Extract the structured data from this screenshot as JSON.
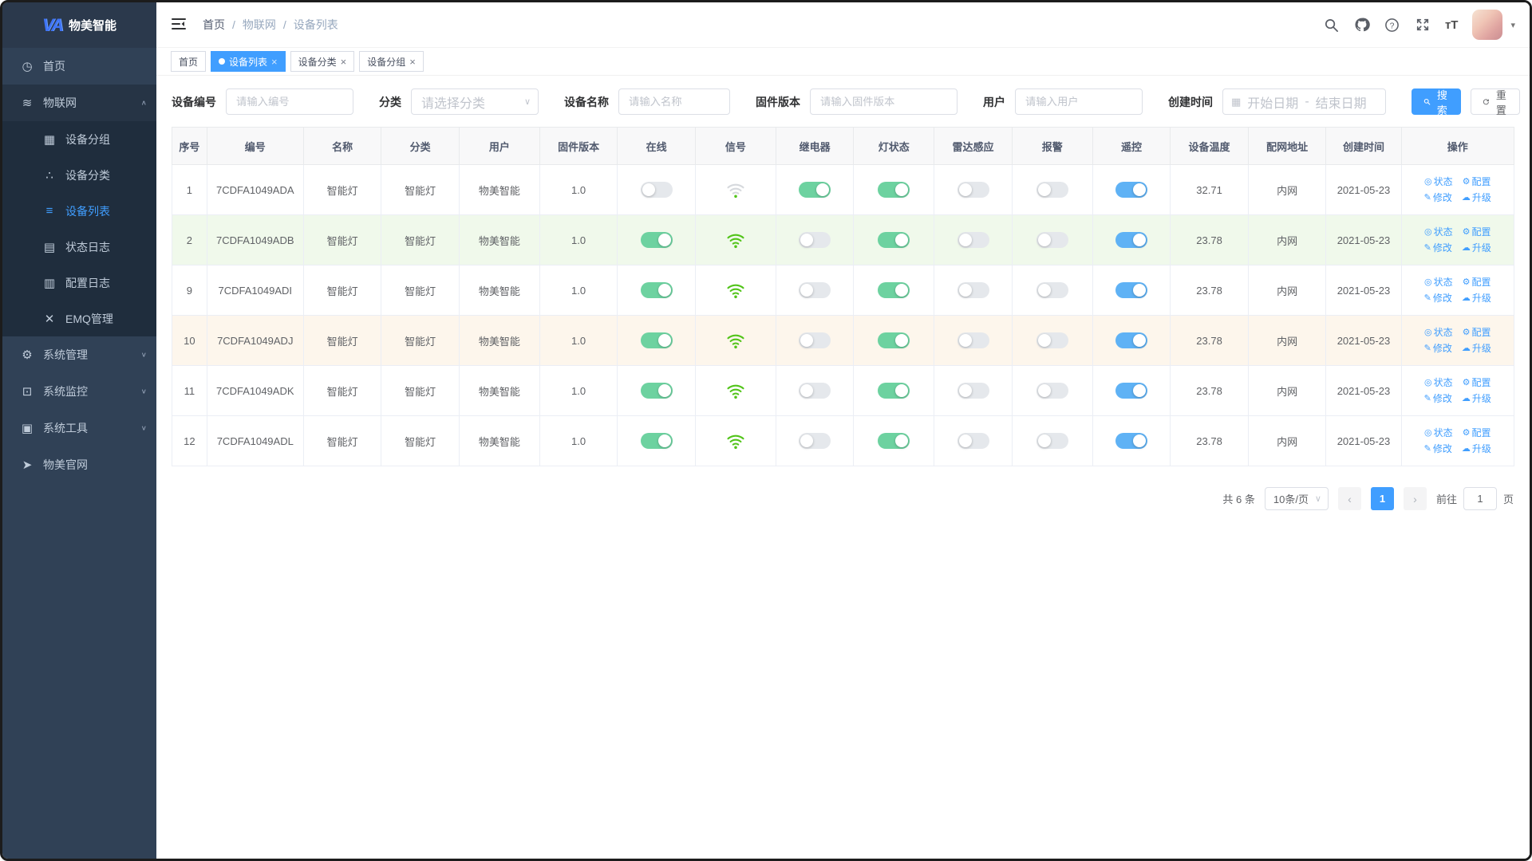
{
  "app": {
    "logo_mark": "VA",
    "logo_text": "物美智能"
  },
  "colors": {
    "primary": "#409eff",
    "sidebar_bg": "#304156",
    "submenu_bg": "#1f2d3d",
    "toggle_green": "#6dd2a0",
    "toggle_blue": "#5fb2f5",
    "row_tint_green": "#f0f9eb",
    "row_tint_orange": "#fdf6ec"
  },
  "sidebar": {
    "menu": [
      {
        "id": "home",
        "label": "首页",
        "icon": "dashboard-icon"
      },
      {
        "id": "iot",
        "label": "物联网",
        "icon": "iot-icon",
        "expanded": true,
        "children": [
          {
            "id": "device-group",
            "label": "设备分组",
            "icon": "grid-icon"
          },
          {
            "id": "device-category",
            "label": "设备分类",
            "icon": "category-icon"
          },
          {
            "id": "device-list",
            "label": "设备列表",
            "icon": "list-icon",
            "active": true
          },
          {
            "id": "status-log",
            "label": "状态日志",
            "icon": "status-log-icon"
          },
          {
            "id": "config-log",
            "label": "配置日志",
            "icon": "config-log-icon"
          },
          {
            "id": "emq",
            "label": "EMQ管理",
            "icon": "emq-icon"
          }
        ]
      },
      {
        "id": "system-mgmt",
        "label": "系统管理",
        "icon": "gear-icon",
        "expanded": false,
        "children": []
      },
      {
        "id": "system-monitor",
        "label": "系统监控",
        "icon": "monitor-icon",
        "expanded": false,
        "children": []
      },
      {
        "id": "system-tools",
        "label": "系统工具",
        "icon": "toolbox-icon",
        "expanded": false,
        "children": []
      },
      {
        "id": "official-site",
        "label": "物美官网",
        "icon": "paper-plane-icon"
      }
    ]
  },
  "navbar": {
    "breadcrumb": [
      "首页",
      "物联网",
      "设备列表"
    ],
    "breadcrumb_separator": "/",
    "right_icons": [
      "search-icon",
      "github-icon",
      "question-icon",
      "fullscreen-icon",
      "font-size-icon"
    ]
  },
  "tags": [
    {
      "id": "home",
      "label": "首页",
      "active": false,
      "closable": false
    },
    {
      "id": "device-list",
      "label": "设备列表",
      "active": true,
      "closable": true
    },
    {
      "id": "device-category",
      "label": "设备分类",
      "active": false,
      "closable": true
    },
    {
      "id": "device-group",
      "label": "设备分组",
      "active": false,
      "closable": true
    }
  ],
  "filters": {
    "fields": [
      {
        "id": "device-code",
        "label": "设备编号",
        "type": "input",
        "placeholder": "请输入编号",
        "value": ""
      },
      {
        "id": "category",
        "label": "分类",
        "type": "select",
        "placeholder": "请选择分类",
        "value": ""
      },
      {
        "id": "device-name",
        "label": "设备名称",
        "type": "input",
        "placeholder": "请输入名称",
        "value": ""
      },
      {
        "id": "firmware",
        "label": "固件版本",
        "type": "input",
        "placeholder": "请输入固件版本",
        "value": ""
      },
      {
        "id": "user",
        "label": "用户",
        "type": "input",
        "placeholder": "请输入用户",
        "value": ""
      },
      {
        "id": "created",
        "label": "创建时间",
        "type": "daterange",
        "start_placeholder": "开始日期",
        "separator": "-",
        "end_placeholder": "结束日期"
      }
    ],
    "search_label": "搜索",
    "reset_label": "重置"
  },
  "table": {
    "columns": [
      {
        "key": "index",
        "label": "序号",
        "type": "text",
        "width": "2.6%"
      },
      {
        "key": "code",
        "label": "编号",
        "type": "text",
        "width": "7.2%"
      },
      {
        "key": "name",
        "label": "名称",
        "type": "text",
        "width": "5.8%"
      },
      {
        "key": "category",
        "label": "分类",
        "type": "text",
        "width": "5.8%"
      },
      {
        "key": "user",
        "label": "用户",
        "type": "text",
        "width": "6.0%"
      },
      {
        "key": "firmware",
        "label": "固件版本",
        "type": "text",
        "width": "5.8%"
      },
      {
        "key": "online",
        "label": "在线",
        "type": "switch-green",
        "width": "5.8%"
      },
      {
        "key": "signal",
        "label": "信号",
        "type": "wifi",
        "width": "6.0%"
      },
      {
        "key": "relay",
        "label": "继电器",
        "type": "switch-green",
        "width": "5.8%"
      },
      {
        "key": "light",
        "label": "灯状态",
        "type": "switch-green",
        "width": "6.0%"
      },
      {
        "key": "radar",
        "label": "雷达感应",
        "type": "switch-green",
        "width": "5.8%"
      },
      {
        "key": "alarm",
        "label": "报警",
        "type": "switch-green",
        "width": "6.0%"
      },
      {
        "key": "remote",
        "label": "遥控",
        "type": "switch-blue",
        "width": "5.8%"
      },
      {
        "key": "temperature",
        "label": "设备温度",
        "type": "text",
        "width": "5.8%"
      },
      {
        "key": "network",
        "label": "配网地址",
        "type": "text",
        "width": "5.8%"
      },
      {
        "key": "created",
        "label": "创建时间",
        "type": "text",
        "width": "5.6%"
      },
      {
        "key": "actions",
        "label": "操作",
        "type": "actions",
        "width": "8.4%"
      }
    ],
    "actions": [
      {
        "id": "status",
        "label": "状态",
        "icon": "view-icon"
      },
      {
        "id": "config",
        "label": "配置",
        "icon": "config-icon"
      },
      {
        "id": "edit",
        "label": "修改",
        "icon": "edit-icon"
      },
      {
        "id": "upgrade",
        "label": "升级",
        "icon": "upgrade-icon"
      }
    ],
    "rows": [
      {
        "index": "1",
        "code": "7CDFA1049ADA",
        "name": "智能灯",
        "category": "智能灯",
        "user": "物美智能",
        "firmware": "1.0",
        "online": false,
        "signal": "weak",
        "relay": true,
        "light": true,
        "radar": false,
        "alarm": false,
        "remote": true,
        "temperature": "32.71",
        "network": "内网",
        "created": "2021-05-23",
        "tint": "none"
      },
      {
        "index": "2",
        "code": "7CDFA1049ADB",
        "name": "智能灯",
        "category": "智能灯",
        "user": "物美智能",
        "firmware": "1.0",
        "online": true,
        "signal": "strong",
        "relay": false,
        "light": true,
        "radar": false,
        "alarm": false,
        "remote": true,
        "temperature": "23.78",
        "network": "内网",
        "created": "2021-05-23",
        "tint": "green"
      },
      {
        "index": "9",
        "code": "7CDFA1049ADI",
        "name": "智能灯",
        "category": "智能灯",
        "user": "物美智能",
        "firmware": "1.0",
        "online": true,
        "signal": "strong",
        "relay": false,
        "light": true,
        "radar": false,
        "alarm": false,
        "remote": true,
        "temperature": "23.78",
        "network": "内网",
        "created": "2021-05-23",
        "tint": "none"
      },
      {
        "index": "10",
        "code": "7CDFA1049ADJ",
        "name": "智能灯",
        "category": "智能灯",
        "user": "物美智能",
        "firmware": "1.0",
        "online": true,
        "signal": "strong",
        "relay": false,
        "light": true,
        "radar": false,
        "alarm": false,
        "remote": true,
        "temperature": "23.78",
        "network": "内网",
        "created": "2021-05-23",
        "tint": "orange"
      },
      {
        "index": "11",
        "code": "7CDFA1049ADK",
        "name": "智能灯",
        "category": "智能灯",
        "user": "物美智能",
        "firmware": "1.0",
        "online": true,
        "signal": "strong",
        "relay": false,
        "light": true,
        "radar": false,
        "alarm": false,
        "remote": true,
        "temperature": "23.78",
        "network": "内网",
        "created": "2021-05-23",
        "tint": "none"
      },
      {
        "index": "12",
        "code": "7CDFA1049ADL",
        "name": "智能灯",
        "category": "智能灯",
        "user": "物美智能",
        "firmware": "1.0",
        "online": true,
        "signal": "strong",
        "relay": false,
        "light": true,
        "radar": false,
        "alarm": false,
        "remote": true,
        "temperature": "23.78",
        "network": "内网",
        "created": "2021-05-23",
        "tint": "none"
      }
    ]
  },
  "pagination": {
    "total_text": "共 6 条",
    "page_size_text": "10条/页",
    "current_page": "1",
    "goto_label": "前往",
    "goto_value": "1",
    "goto_suffix": "页"
  }
}
